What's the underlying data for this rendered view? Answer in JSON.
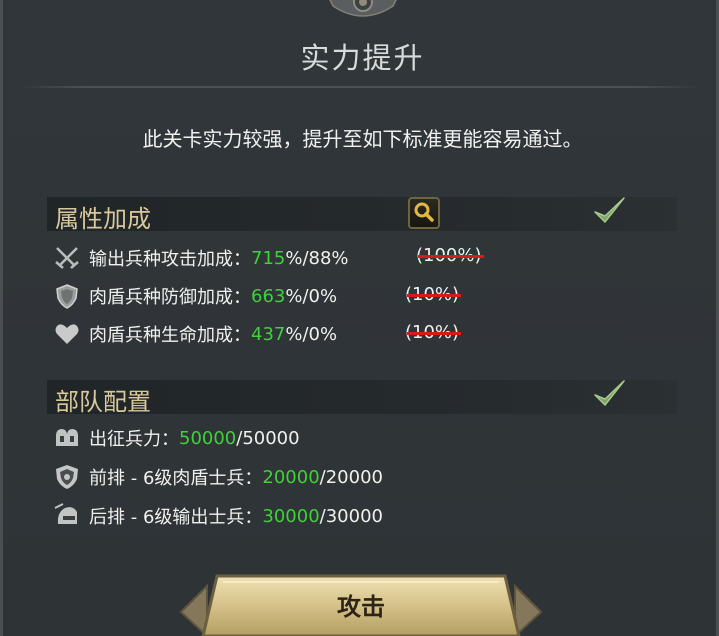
{
  "title": "实力提升",
  "description": "此关卡实力较强，提升至如下标准更能容易通过。",
  "attributes": {
    "label": "属性加成",
    "complete": true,
    "rows": [
      {
        "icon": "crossed-swords-icon",
        "label": "输出兵种攻击加成：",
        "current": "715",
        "rest": "%/88%",
        "struck": "(100%)"
      },
      {
        "icon": "shield-icon",
        "label": "肉盾兵种防御加成：",
        "current": "663",
        "rest": "%/0%",
        "struck": "(10%)"
      },
      {
        "icon": "heart-icon",
        "label": "肉盾兵种生命加成：",
        "current": "437",
        "rest": "%/0%",
        "struck": "(10%)"
      }
    ]
  },
  "troops": {
    "label": "部队配置",
    "complete": true,
    "rows": [
      {
        "icon": "helmet-group-icon",
        "label": "出征兵力：",
        "current": "50000",
        "rest": "/50000"
      },
      {
        "icon": "shield-badge-icon",
        "label": "前排 - 6级肉盾士兵：",
        "current": "20000",
        "rest": "/20000"
      },
      {
        "icon": "archer-helmet-icon",
        "label": "后排 - 6级输出士兵：",
        "current": "30000",
        "rest": "/30000"
      }
    ]
  },
  "attack_button": {
    "label": "攻击"
  },
  "colors": {
    "accent_green": "#3fd13a",
    "gold": "#d8c89b",
    "strike_red": "#d61c17"
  }
}
